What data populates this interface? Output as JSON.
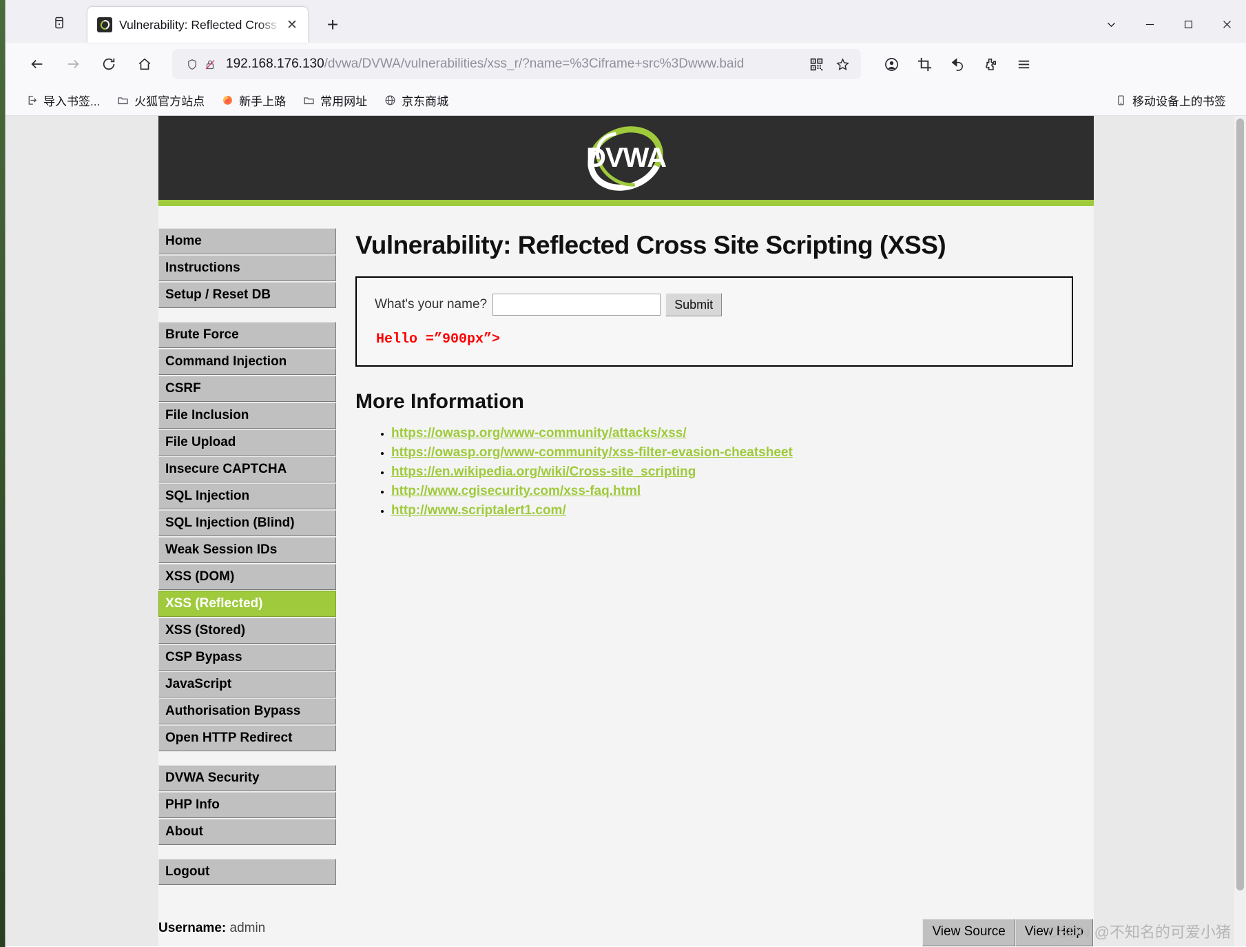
{
  "window": {
    "controls": {
      "list": "chevron-down",
      "minimize": "—",
      "maximize": "▢",
      "close": "✕"
    }
  },
  "tabstrip": {
    "firefox_view_title": "Firefox View",
    "tab": {
      "title": "Vulnerability: Reflected Cross Site Scripting (XSS) :: Damn Vulnerable Web Application (DVWA)",
      "display_title": "Vulnerability: Reflected Cross",
      "close_label": "✕"
    },
    "new_tab_label": "+"
  },
  "navbar": {
    "back_label": "←",
    "forward_label": "→",
    "reload_label": "⟳",
    "home_label": "⌂",
    "url": {
      "host": "192.168.176.130",
      "path": "/dvwa/DVWA/vulnerabilities/xss_r/?name=%3Ciframe+src%3Dwww.baid",
      "full": "192.168.176.130/dvwa/DVWA/vulnerabilities/xss_r/?name=%3Ciframe+src%3Dwww.baid"
    },
    "qr_title": "QR code",
    "bookmark_star_title": "Bookmark this page",
    "right_icons": [
      "account-icon",
      "screenshot-icon",
      "undo-icon",
      "extensions-icon",
      "app-menu-icon"
    ]
  },
  "bookmarks": {
    "items": [
      {
        "label": "导入书签...",
        "icon": "import-icon"
      },
      {
        "label": "火狐官方站点",
        "icon": "folder-icon"
      },
      {
        "label": "新手上路",
        "icon": "firefox-icon"
      },
      {
        "label": "常用网址",
        "icon": "folder-icon"
      },
      {
        "label": "京东商城",
        "icon": "globe-icon"
      }
    ],
    "right_item": {
      "label": "移动设备上的书签",
      "icon": "mobile-icon"
    }
  },
  "dvwa": {
    "logo_text": "DVWA",
    "page_title": "Vulnerability: Reflected Cross Site Scripting (XSS)",
    "form": {
      "label": "What's your name?",
      "input_value": "",
      "input_placeholder": "",
      "submit_label": "Submit"
    },
    "output": "Hello =”900px”>",
    "more_info_heading": "More Information",
    "links": [
      "https://owasp.org/www-community/attacks/xss/",
      "https://owasp.org/www-community/xss-filter-evasion-cheatsheet",
      "https://en.wikipedia.org/wiki/Cross-site_scripting",
      "http://www.cgisecurity.com/xss-faq.html",
      "http://www.scriptalert1.com/"
    ],
    "menu": {
      "group1": [
        "Home",
        "Instructions",
        "Setup / Reset DB"
      ],
      "group2": [
        "Brute Force",
        "Command Injection",
        "CSRF",
        "File Inclusion",
        "File Upload",
        "Insecure CAPTCHA",
        "SQL Injection",
        "SQL Injection (Blind)",
        "Weak Session IDs",
        "XSS (DOM)",
        "XSS (Reflected)",
        "XSS (Stored)",
        "CSP Bypass",
        "JavaScript",
        "Authorisation Bypass",
        "Open HTTP Redirect"
      ],
      "group3": [
        "DVWA Security",
        "PHP Info",
        "About"
      ],
      "group4": [
        "Logout"
      ],
      "active": "XSS (Reflected)"
    },
    "status": {
      "username_label": "Username:",
      "username_value": "admin"
    },
    "footer_buttons": [
      "View Source",
      "View Help"
    ]
  },
  "watermark": "CSDN @不知名的可爱小猪",
  "colors": {
    "dvwa_green": "#9fca3c",
    "dvwa_header_dark": "#2e2e2e",
    "output_red": "#fe0000",
    "menu_gray": "#c0c0c0"
  }
}
